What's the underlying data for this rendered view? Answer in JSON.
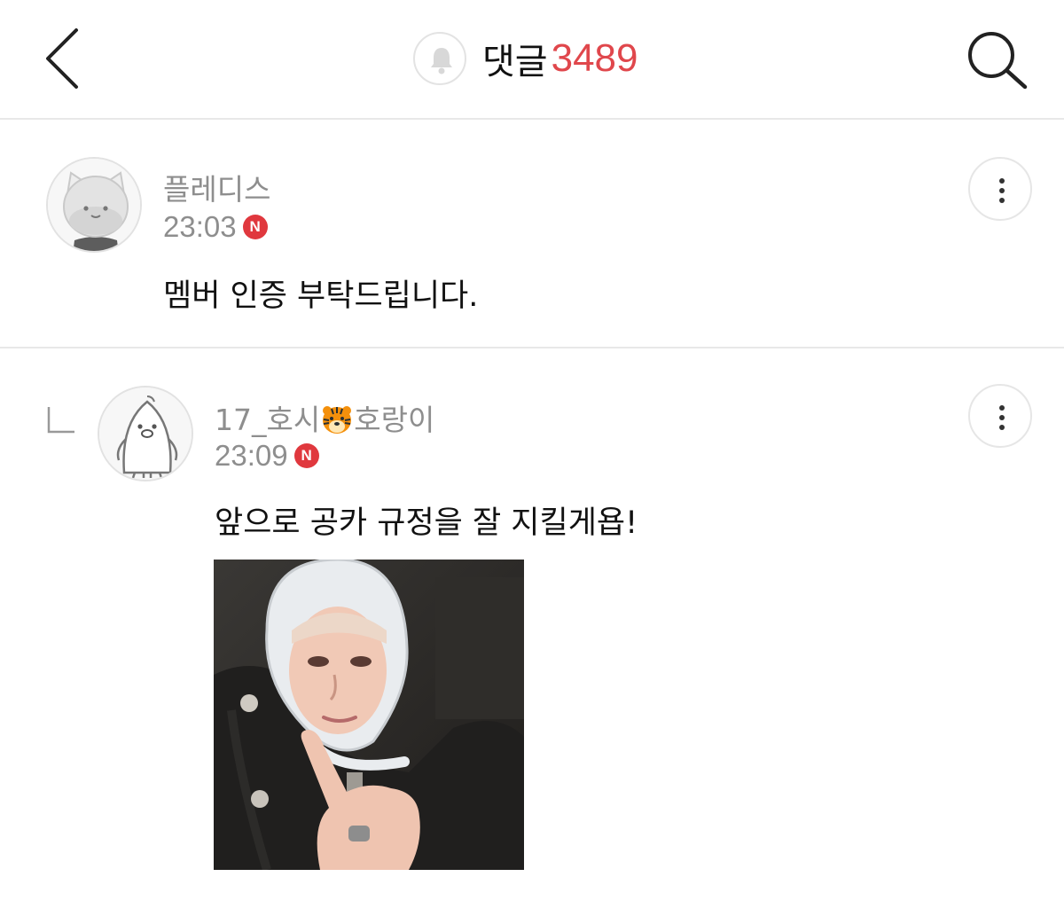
{
  "header": {
    "title_label": "댓글",
    "comment_count": "3489",
    "icons": {
      "back": "chevron-left-icon",
      "notify": "bell-icon",
      "search": "search-icon"
    },
    "accent_color": "#e0474c"
  },
  "comments": [
    {
      "username": "플레디스",
      "time": "23:03",
      "badge": "N",
      "text": "멤버 인증 부탁드립니다.",
      "is_reply": false,
      "avatar_icon": "cat-avatar-icon"
    },
    {
      "username_prefix": "17_호시",
      "username_emoji": "tiger-face-icon",
      "username_suffix": "호랑이",
      "time": "23:09",
      "badge": "N",
      "text": "앞으로 공카 규정을 잘 지킬게욥!",
      "is_reply": true,
      "avatar_icon": "penguin-avatar-icon",
      "has_photo": true
    }
  ],
  "badge_color": "#e0383e"
}
